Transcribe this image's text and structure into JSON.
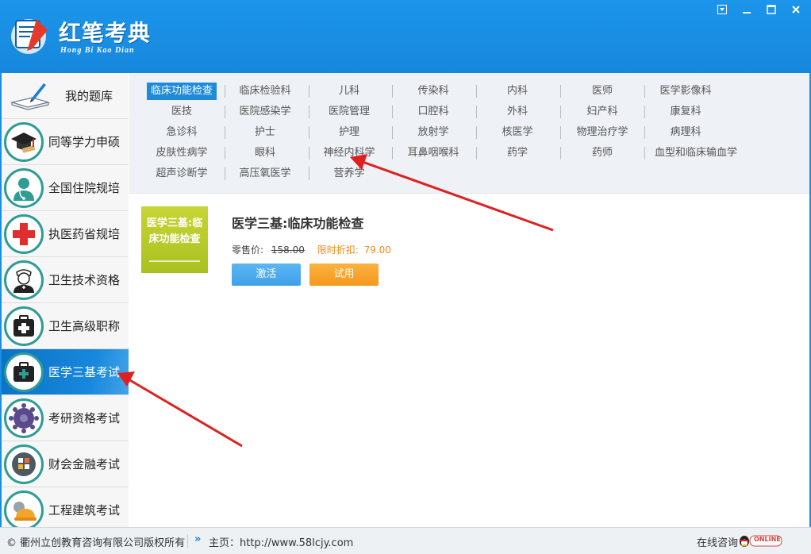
{
  "app": {
    "title": "红笔考典",
    "pinyin": "Hong Bi Kao Dian",
    "window_controls": [
      "dropdown-icon",
      "minimize-icon",
      "maximize-icon",
      "close-icon"
    ]
  },
  "sidebar": {
    "items": [
      {
        "label": "我的题库",
        "icon": "notebook-pen-icon"
      },
      {
        "label": "同等学力申硕",
        "icon": "graduation-cap-icon"
      },
      {
        "label": "全国住院规培",
        "icon": "doctor-icon"
      },
      {
        "label": "执医药省规培",
        "icon": "red-cross-icon"
      },
      {
        "label": "卫生技术资格",
        "icon": "nurse-icon"
      },
      {
        "label": "卫生高级职称",
        "icon": "first-aid-kit-icon"
      },
      {
        "label": "医学三基考试",
        "icon": "medical-bag-icon",
        "active": true
      },
      {
        "label": "考研资格考试",
        "icon": "gear-cluster-icon"
      },
      {
        "label": "财会金融考试",
        "icon": "calculator-icon"
      },
      {
        "label": "工程建筑考试",
        "icon": "hard-hat-icon"
      }
    ]
  },
  "categories": {
    "rows": [
      [
        "临床功能检查",
        "临床检验科",
        "儿科",
        "传染科",
        "内科",
        "医师",
        "医学影像科"
      ],
      [
        "医技",
        "医院感染学",
        "医院管理",
        "口腔科",
        "外科",
        "妇产科",
        "康复科"
      ],
      [
        "急诊科",
        "护士",
        "护理",
        "放射学",
        "核医学",
        "物理治疗学",
        "病理科"
      ],
      [
        "皮肤性病学",
        "眼科",
        "神经内科学",
        "耳鼻咽喉科",
        "药学",
        "药师",
        "血型和临床输血学"
      ],
      [
        "超声诊断学",
        "高压氧医学",
        "营养学"
      ]
    ],
    "active": "临床功能检查"
  },
  "product": {
    "cover_text": "医学三基:临床功能检查",
    "title": "医学三基:临床功能检查",
    "retail_label": "零售价:",
    "retail_price": "158.00",
    "sale_label": "限时折扣:",
    "sale_price": "79.00",
    "activate_label": "激活",
    "trial_label": "试用"
  },
  "footer": {
    "copyright": "© 衢州立创教育咨询有限公司版权所有",
    "home": "主页：http://www.58lcjy.com",
    "online": "在线咨询",
    "qq_badge": "ONLINE"
  },
  "colors": {
    "header_blue": "#1a8fe0",
    "active_blue": "#1f8bd8",
    "sale_orange": "#f08a1a",
    "book_green": "#b5c92a",
    "arrow_red": "#e02020"
  }
}
